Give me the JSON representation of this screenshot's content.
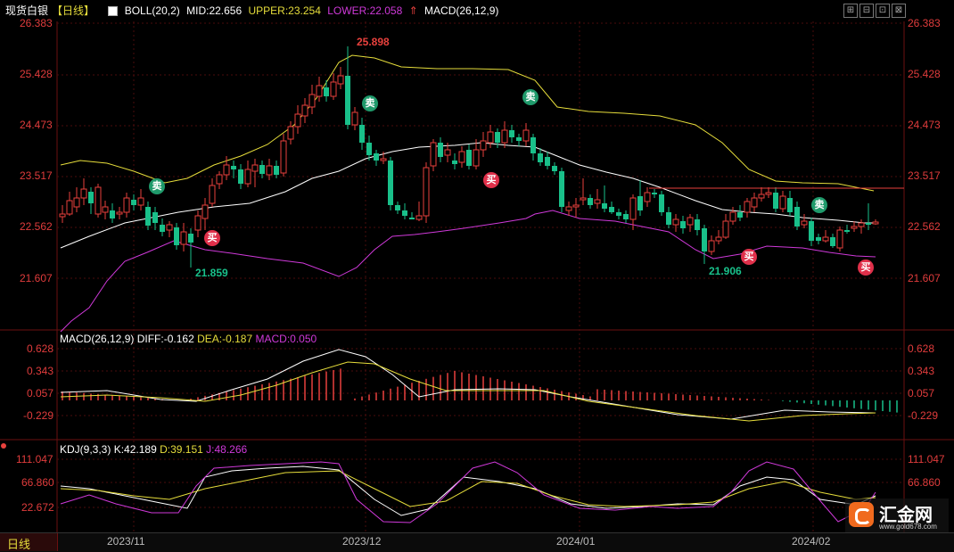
{
  "header": {
    "title": "现货白银",
    "period_tag": "【日线】",
    "boll_label": "BOLL(20,2)",
    "mid": "MID:22.656",
    "upper": "UPPER:23.254",
    "lower": "LOWER:22.058",
    "macd_label": "MACD(26,12,9)"
  },
  "colors": {
    "up": "#e8413d",
    "down": "#19c08a",
    "mid": "#ffffff",
    "upper": "#e6dd3b",
    "lower": "#cf39d9",
    "dea": "#e6dd3b",
    "macd_text": "#cf39d9",
    "grid": "#3b0a0a"
  },
  "price_axis": {
    "ticks": [
      "26.383",
      "25.428",
      "24.473",
      "23.517",
      "22.562",
      "21.607"
    ]
  },
  "annotations": {
    "high": "25.898",
    "low1": "21.859",
    "low2": "21.906",
    "sell_text": "卖",
    "buy_text": "买"
  },
  "macd_panel": {
    "label": "MACD(26,12,9)",
    "diff": "DIFF:-0.162",
    "dea": "DEA:-0.187",
    "macd": "MACD:0.050",
    "ticks": [
      "0.628",
      "0.343",
      "0.057",
      "-0.229"
    ]
  },
  "kdj_panel": {
    "label": "KDJ(9,3,3)",
    "k": "K:42.189",
    "d": "D:39.151",
    "j": "J:48.266",
    "ticks": [
      "111.047",
      "66.860",
      "22.672"
    ]
  },
  "bottom_bar": {
    "period": "日线",
    "dates": [
      "2023/11",
      "2023/12",
      "2024/01",
      "2024/02"
    ]
  },
  "brand": {
    "name": "汇金网",
    "url": "www.gold678.com"
  },
  "window_buttons": [
    "⊞",
    "⊟",
    "⊡",
    "⊠"
  ]
}
